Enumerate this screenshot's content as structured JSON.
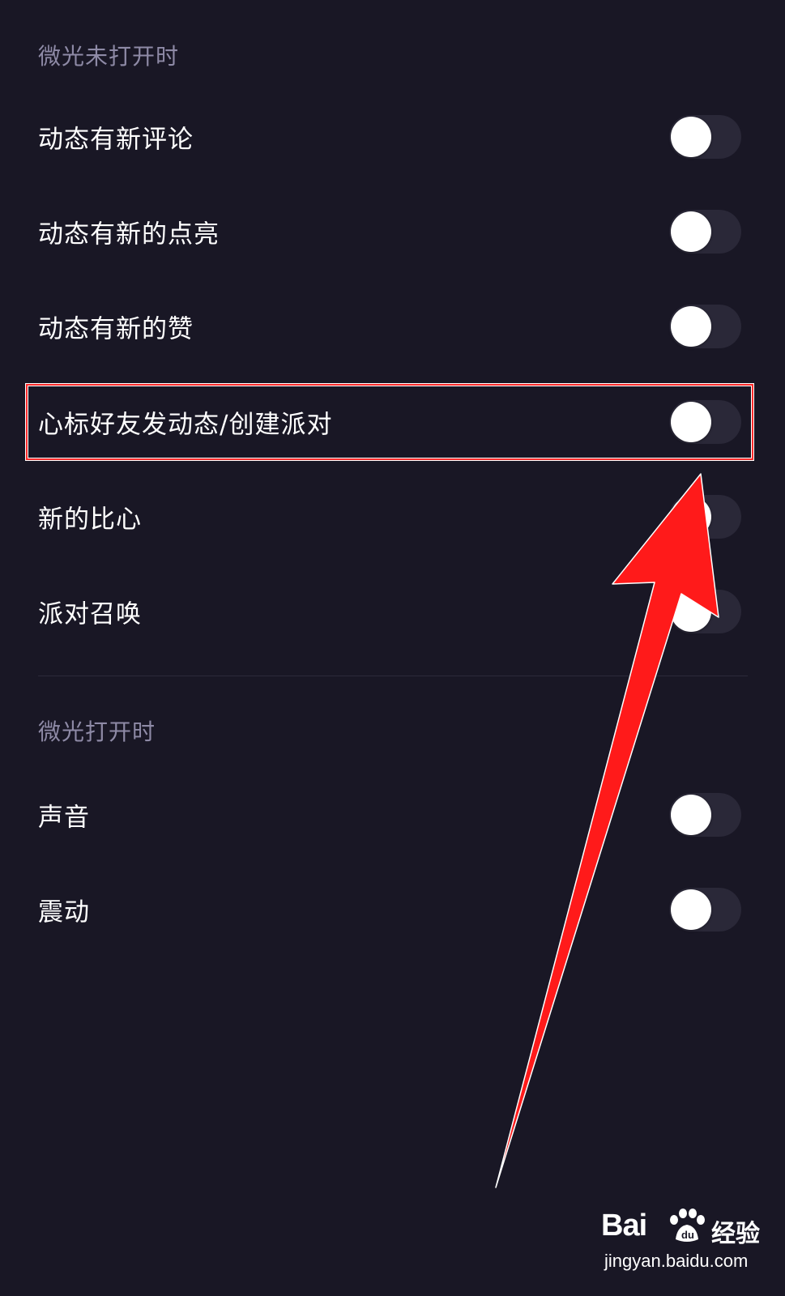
{
  "sections": [
    {
      "header": "微光未打开时",
      "items": [
        {
          "label": "动态有新评论",
          "on": false
        },
        {
          "label": "动态有新的点亮",
          "on": false
        },
        {
          "label": "动态有新的赞",
          "on": false
        },
        {
          "label": "心标好友发动态/创建派对",
          "on": false
        },
        {
          "label": "新的比心",
          "on": false
        },
        {
          "label": "派对召唤",
          "on": false
        }
      ]
    },
    {
      "header": "微光打开时",
      "items": [
        {
          "label": "声音",
          "on": false
        },
        {
          "label": "震动",
          "on": false
        }
      ]
    }
  ],
  "annotation": {
    "highlight_color": "#ff2a2a",
    "highlighted_item": "心标好友发动态/创建派对"
  },
  "watermark": {
    "logo_text": "Bai",
    "logo_cn": "经验",
    "url": "jingyan.baidu.com"
  },
  "colors": {
    "background": "#191725",
    "header_text": "#8e8aa6",
    "label_text": "#ffffff",
    "toggle_track_off": "#2a2838",
    "toggle_knob": "#ffffff"
  }
}
